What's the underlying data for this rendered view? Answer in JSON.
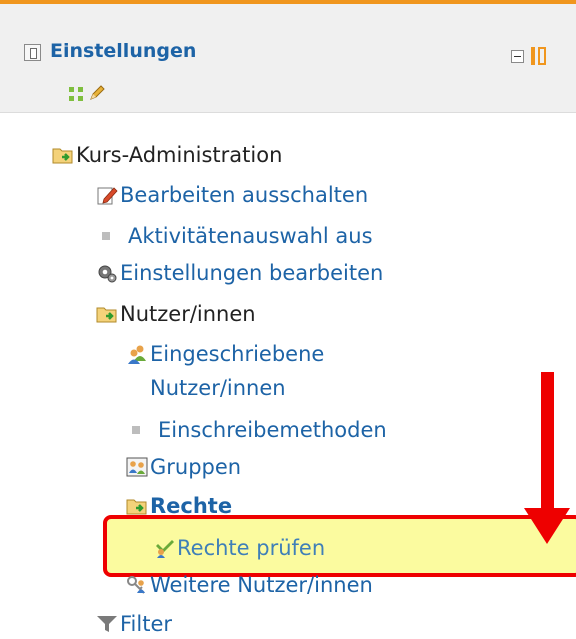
{
  "block": {
    "title": "Einstellungen",
    "accent_color": "#f0961e"
  },
  "tree": {
    "kurs_admin": "Kurs-Administration",
    "bearbeiten": "Bearbeiten ausschalten",
    "aktivitaeten": "Aktivitätenauswahl aus",
    "einstellungen_bearbeiten": "Einstellungen bearbeiten",
    "nutzer": "Nutzer/innen",
    "eingeschriebene_1": "Eingeschriebene",
    "eingeschriebene_2": "Nutzer/innen",
    "einschreibemethoden": "Einschreibemethoden",
    "gruppen": "Gruppen",
    "rechte": "Rechte",
    "rechte_pruefen": "Rechte prüfen",
    "weitere": "Weitere Nutzer/innen",
    "filter": "Filter"
  },
  "annotation": {
    "highlight_color": "#ee0000",
    "highlight_fill": "#fbfb9f"
  }
}
